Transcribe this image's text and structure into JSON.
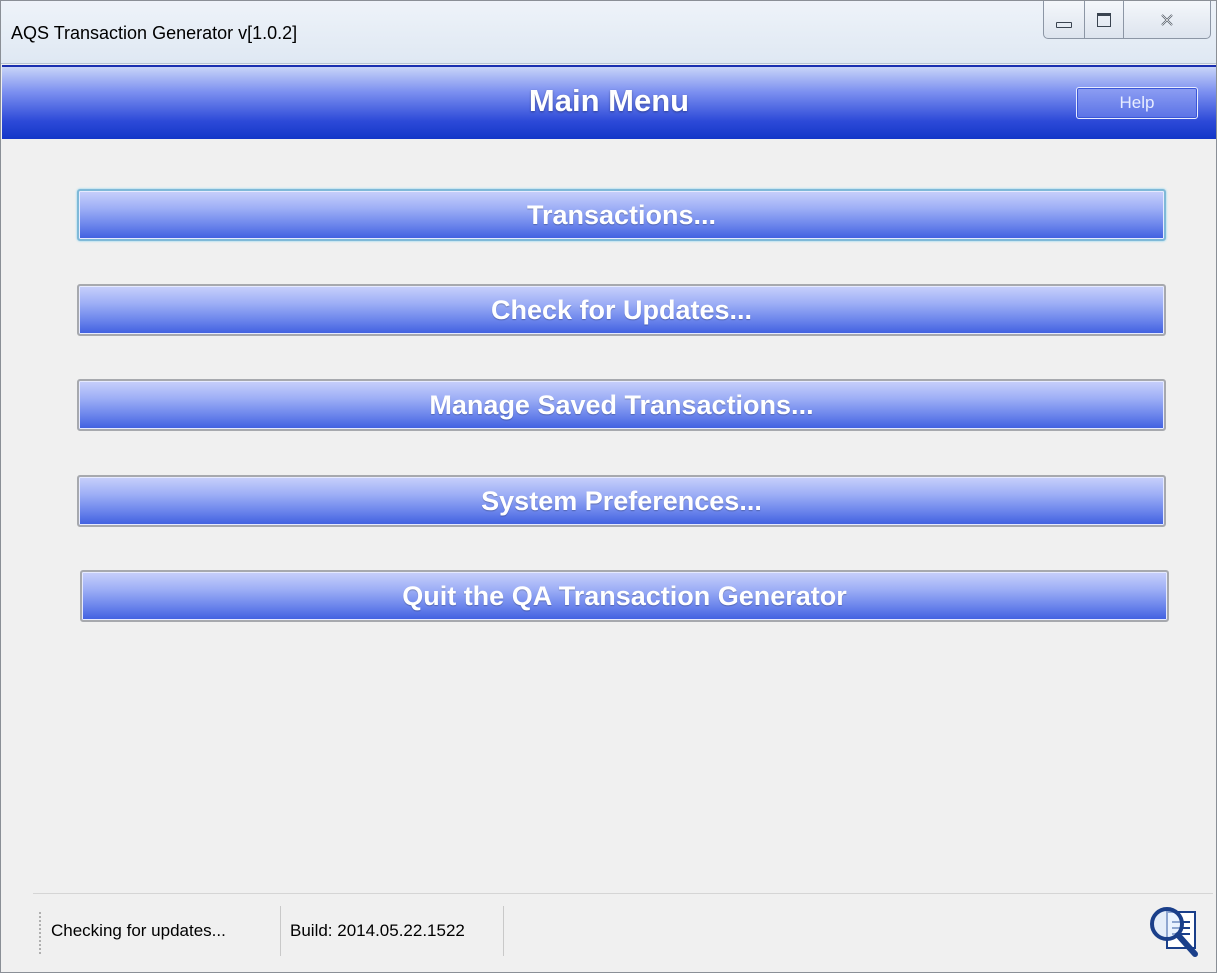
{
  "window": {
    "title": "AQS Transaction Generator v[1.0.2]",
    "controls": [
      "minimize-icon",
      "maximize-icon",
      "close-icon"
    ]
  },
  "header": {
    "title": "Main Menu",
    "help_label": "Help"
  },
  "menu": {
    "items": [
      {
        "label": "Transactions..."
      },
      {
        "label": "Check for Updates..."
      },
      {
        "label": "Manage Saved Transactions..."
      },
      {
        "label": "System Preferences..."
      },
      {
        "label": "Quit the QA Transaction Generator"
      }
    ]
  },
  "status": {
    "message": "Checking for updates...",
    "build": "Build: 2014.05.22.1522",
    "icon": "search-document-icon"
  },
  "colors": {
    "header_blue": "#1336c8",
    "button_blue": "#6d86ec",
    "background": "#f0f0f0"
  }
}
